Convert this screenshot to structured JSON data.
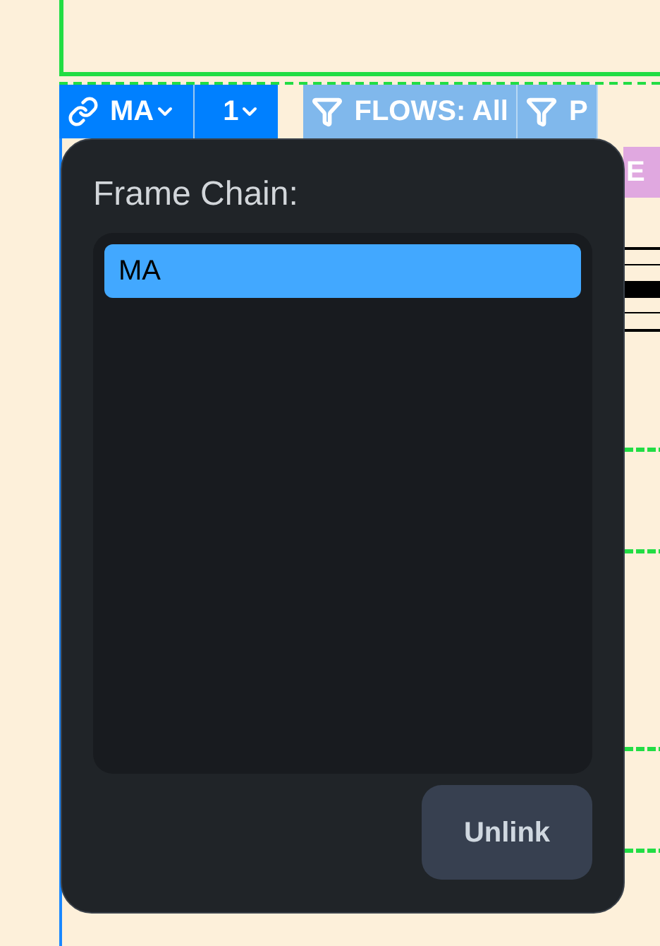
{
  "toolbar": {
    "link_button": {
      "label": "MA"
    },
    "frame_button": {
      "label": "1"
    },
    "filters": [
      {
        "label": "FLOWS: All"
      },
      {
        "label": "P"
      }
    ]
  },
  "tag": {
    "label": "E"
  },
  "popover": {
    "title": "Frame Chain:",
    "items": [
      {
        "label": "MA",
        "selected": true
      }
    ],
    "button": "Unlink"
  }
}
